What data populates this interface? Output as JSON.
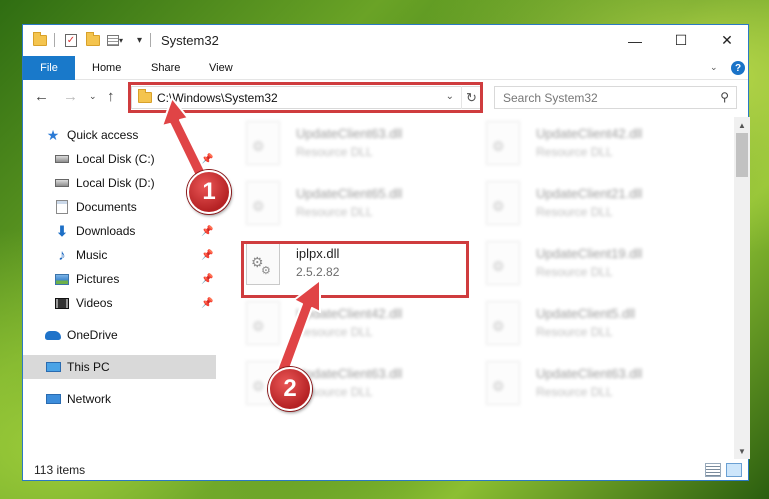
{
  "window": {
    "title": "System32",
    "controls": {
      "minimize": "—",
      "maximize": "☐",
      "close": "✕"
    }
  },
  "ribbon": {
    "tabs": [
      "File",
      "Home",
      "Share",
      "View"
    ],
    "help_label": "?"
  },
  "nav": {
    "address": "C:\\Windows\\System32",
    "search_placeholder": "Search System32"
  },
  "sidebar": {
    "items": [
      {
        "label": "Quick access",
        "icon": "star-icon"
      },
      {
        "label": "Local Disk (C:)",
        "icon": "disk-icon",
        "pinned": true
      },
      {
        "label": "Local Disk (D:)",
        "icon": "disk-icon"
      },
      {
        "label": "Documents",
        "icon": "documents-icon",
        "pinned": true
      },
      {
        "label": "Downloads",
        "icon": "download-icon",
        "pinned": true
      },
      {
        "label": "Music",
        "icon": "music-icon",
        "pinned": true
      },
      {
        "label": "Pictures",
        "icon": "pictures-icon",
        "pinned": true
      },
      {
        "label": "Videos",
        "icon": "videos-icon",
        "pinned": true
      },
      {
        "label": "OneDrive",
        "icon": "onedrive-icon"
      },
      {
        "label": "This PC",
        "icon": "this-pc-icon",
        "selected": true
      },
      {
        "label": "Network",
        "icon": "network-icon"
      }
    ]
  },
  "files": [
    {
      "name": "UpdateClient63.dll",
      "type": "Resource DLL",
      "blurred": true
    },
    {
      "name": "UpdateClient42.dll",
      "type": "Resource DLL",
      "blurred": true
    },
    {
      "name": "UpdateClient65.dll",
      "type": "Resource DLL",
      "blurred": true
    },
    {
      "name": "UpdateClient21.dll",
      "type": "Resource DLL",
      "blurred": true
    },
    {
      "name": "iplpx.dll",
      "type": "2.5.2.82",
      "blurred": false
    },
    {
      "name": "UpdateClient19.dll",
      "type": "Resource DLL",
      "blurred": true
    },
    {
      "name": "UpdateClient42.dll",
      "type": "Resource DLL",
      "blurred": true
    },
    {
      "name": "UpdateClient5.dll",
      "type": "Resource DLL",
      "blurred": true
    },
    {
      "name": "UpdateClient63.dll",
      "type": "Resource DLL",
      "blurred": true
    },
    {
      "name": "UpdateClient63.dll",
      "type": "Resource DLL",
      "blurred": true
    }
  ],
  "status": {
    "item_count": "113 items"
  },
  "callouts": {
    "step1": "1",
    "step2": "2"
  },
  "colors": {
    "accent": "#1979ca",
    "highlight": "#cf3c3e",
    "selected_bg": "#d9d9d9"
  }
}
